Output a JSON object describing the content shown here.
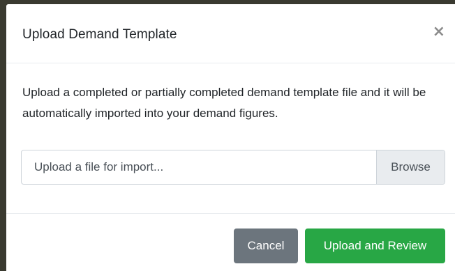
{
  "modal": {
    "title": "Upload Demand Template",
    "close_icon": "close-icon",
    "close_glyph": "×",
    "description": "Upload a completed or partially completed demand template file and it will be automatically imported into your demand figures.",
    "file_input": {
      "placeholder": "Upload a file for import...",
      "browse_label": "Browse"
    },
    "footer": {
      "cancel_label": "Cancel",
      "upload_label": "Upload and Review"
    }
  },
  "colors": {
    "cancel_button": "#6c757d",
    "upload_button": "#28a745",
    "browse_background": "#e9ecef"
  }
}
